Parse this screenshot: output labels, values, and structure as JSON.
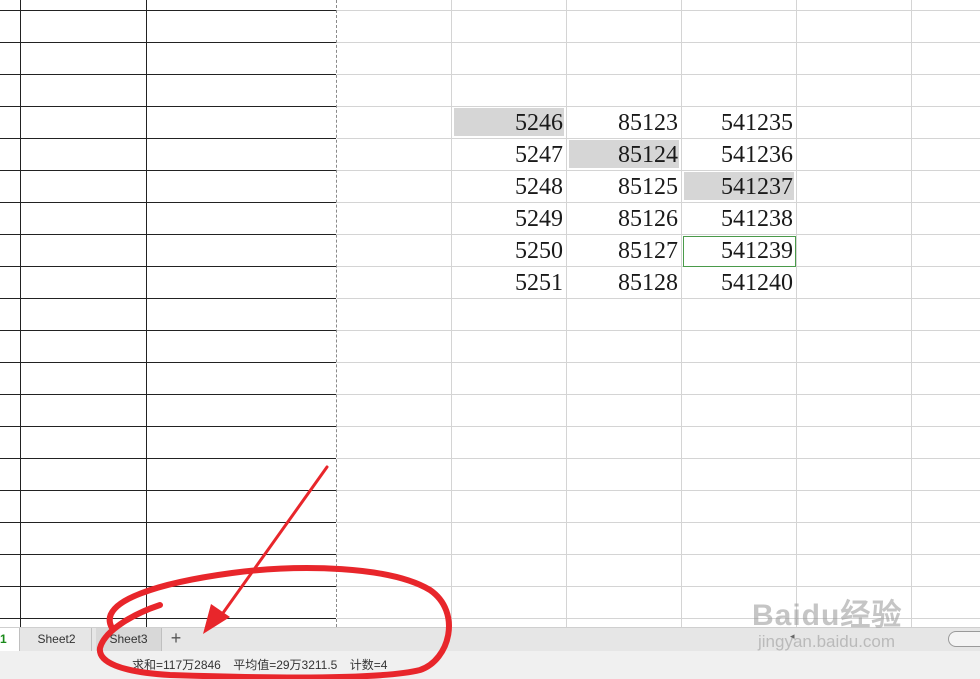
{
  "sheet": {
    "rows": [
      [
        "5246",
        "85123",
        "541235"
      ],
      [
        "5247",
        "85124",
        "541236"
      ],
      [
        "5248",
        "85125",
        "541237"
      ],
      [
        "5249",
        "85126",
        "541238"
      ],
      [
        "5250",
        "85127",
        "541239"
      ],
      [
        "5251",
        "85128",
        "541240"
      ]
    ]
  },
  "tabs": {
    "active_fragment": "1",
    "sheet2": "Sheet2",
    "sheet3": "Sheet3",
    "add": "+"
  },
  "status": {
    "sum": "求和=117万2846",
    "average": "平均值=29万3211.5",
    "count": "计数=4"
  },
  "watermark": {
    "logo": "Baidu经验",
    "url": "jingyan.baidu.com"
  },
  "colors": {
    "annotation": "#e8262b",
    "highlight": "#d6d6d6",
    "active_border": "#4a9a4a"
  }
}
